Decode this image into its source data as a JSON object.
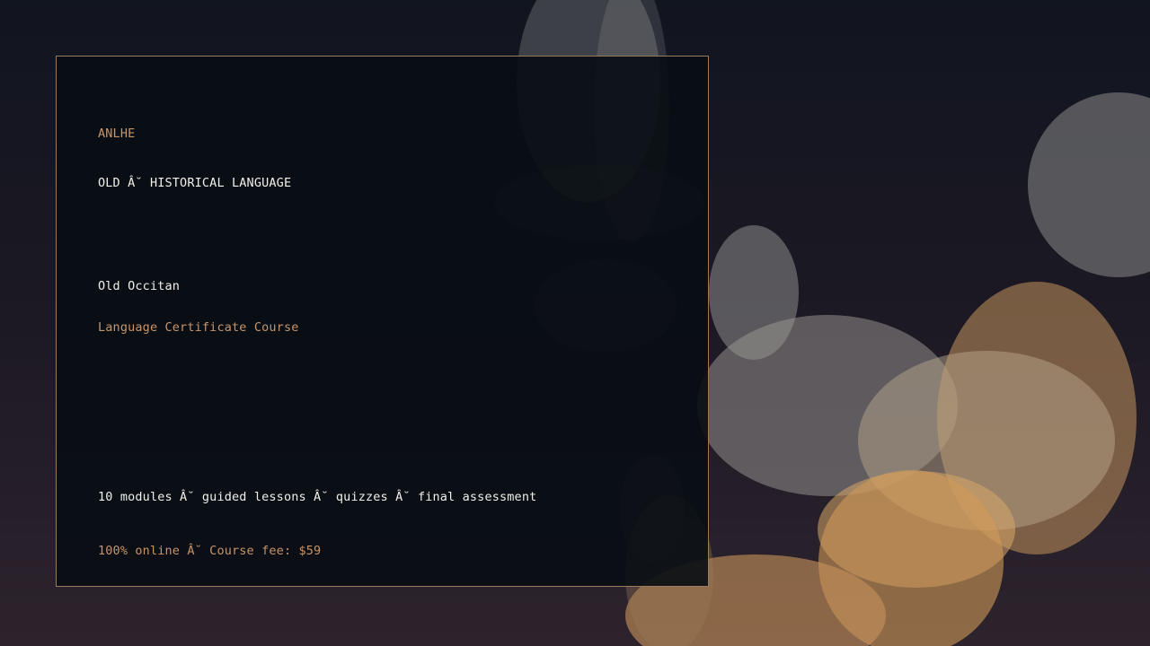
{
  "brand": "ANLHE",
  "category": "OLD Â˘ HISTORICAL LANGUAGE",
  "course": {
    "title": "Old Occitan",
    "subtitle": "Language Certificate Course"
  },
  "details": "10 modules Â˘ guided lessons Â˘ quizzes Â˘ final assessment",
  "pricing": "100% online Â˘ Course fee: $59",
  "colors": {
    "accent": "#c8946a",
    "text": "#f1efe9",
    "card_background": "#080d13",
    "card_border": "#9a7a5a"
  }
}
